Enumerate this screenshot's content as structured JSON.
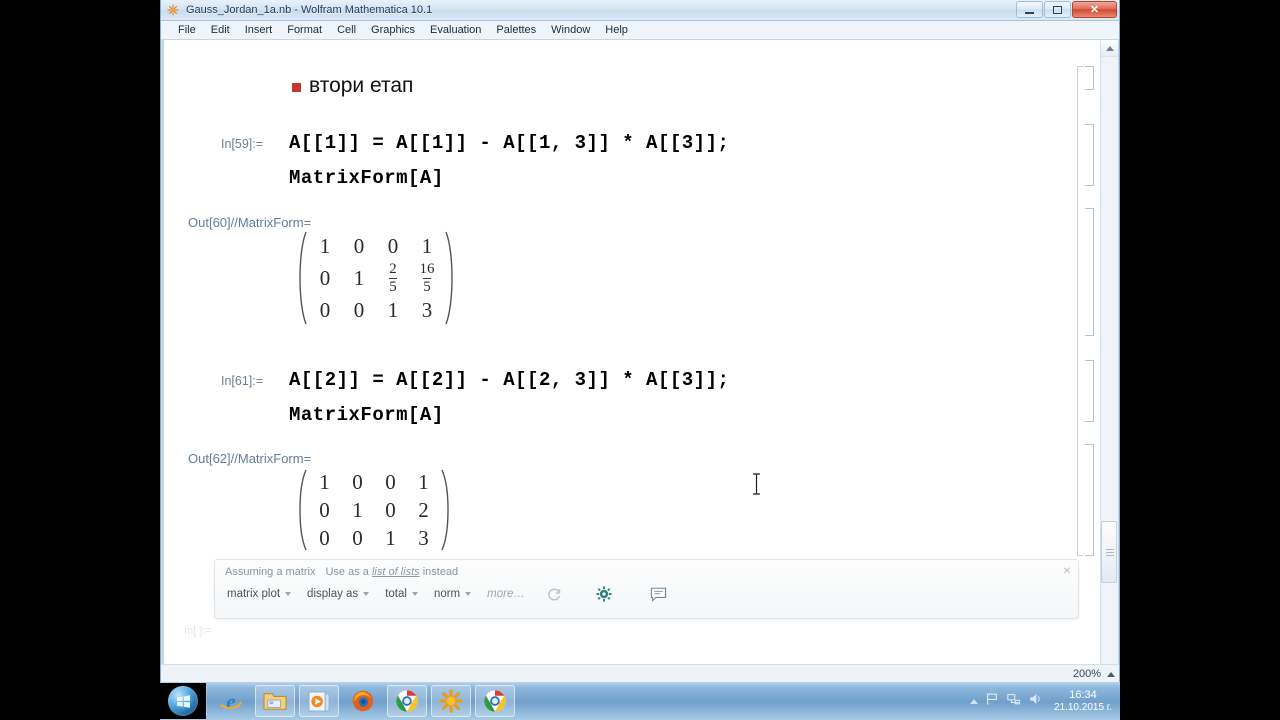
{
  "window": {
    "title": "Gauss_Jordan_1a.nb - Wolfram Mathematica 10.1",
    "app_icon": "mathematica-icon",
    "buttons": {
      "minimize": "minimize-icon",
      "restore": "restore-icon",
      "close": "✕"
    }
  },
  "menubar": {
    "items": [
      "File",
      "Edit",
      "Insert",
      "Format",
      "Cell",
      "Graphics",
      "Evaluation",
      "Palettes",
      "Window",
      "Help"
    ]
  },
  "notebook": {
    "section": {
      "bullet": "red-square-bullet",
      "title": "втори етап"
    },
    "cells": [
      {
        "in_label": "In[59]:=",
        "code_line1": "A[[1]] = A[[1]] - A[[1, 3]] * A[[3]];",
        "code_line2": "MatrixForm[A]",
        "out_label": "Out[60]//MatrixForm=",
        "matrix": [
          [
            "1",
            "0",
            "0",
            "1"
          ],
          [
            "0",
            "1",
            {
              "num": "2",
              "den": "5"
            },
            {
              "num": "16",
              "den": "5"
            }
          ],
          [
            "0",
            "0",
            "1",
            "3"
          ]
        ]
      },
      {
        "in_label": "In[61]:=",
        "code_line1": "A[[2]] = A[[2]] - A[[2, 3]] * A[[3]];",
        "code_line2": "MatrixForm[A]",
        "out_label": "Out[62]//MatrixForm=",
        "matrix": [
          [
            "1",
            "0",
            "0",
            "1"
          ],
          [
            "0",
            "1",
            "0",
            "2"
          ],
          [
            "0",
            "0",
            "1",
            "3"
          ]
        ]
      }
    ],
    "ghost_label": "In[ ]:="
  },
  "suggestion_bar": {
    "assumption": "Assuming a matrix",
    "alternative_prefix": "Use as a ",
    "alternative_link": "list of lists",
    "alternative_suffix": " instead",
    "buttons": [
      "matrix plot",
      "display as",
      "total",
      "norm"
    ],
    "more": "more…",
    "icons": [
      "refresh-icon",
      "gear-icon",
      "comment-icon"
    ],
    "close": "✕"
  },
  "statusbar": {
    "zoom": "200%"
  },
  "taskbar": {
    "start": "windows-start-orb",
    "items": [
      "internet-explorer-icon",
      "windows-explorer-icon",
      "windows-media-player-icon",
      "firefox-icon",
      "chrome-icon",
      "mathematica-icon",
      "chrome-window-icon"
    ],
    "tray": [
      "show-hidden-icons-caret",
      "action-center-flag-icon",
      "network-icon",
      "volume-icon"
    ],
    "clock_time": "16:34",
    "clock_date": "21.10.2015 г."
  },
  "colors": {
    "accent_blue": "#6f9fcb",
    "bullet_red": "#c0392b",
    "in_label": "#6d7f92",
    "out_label": "#5f7e9e",
    "close_red": "#cc4a31"
  }
}
